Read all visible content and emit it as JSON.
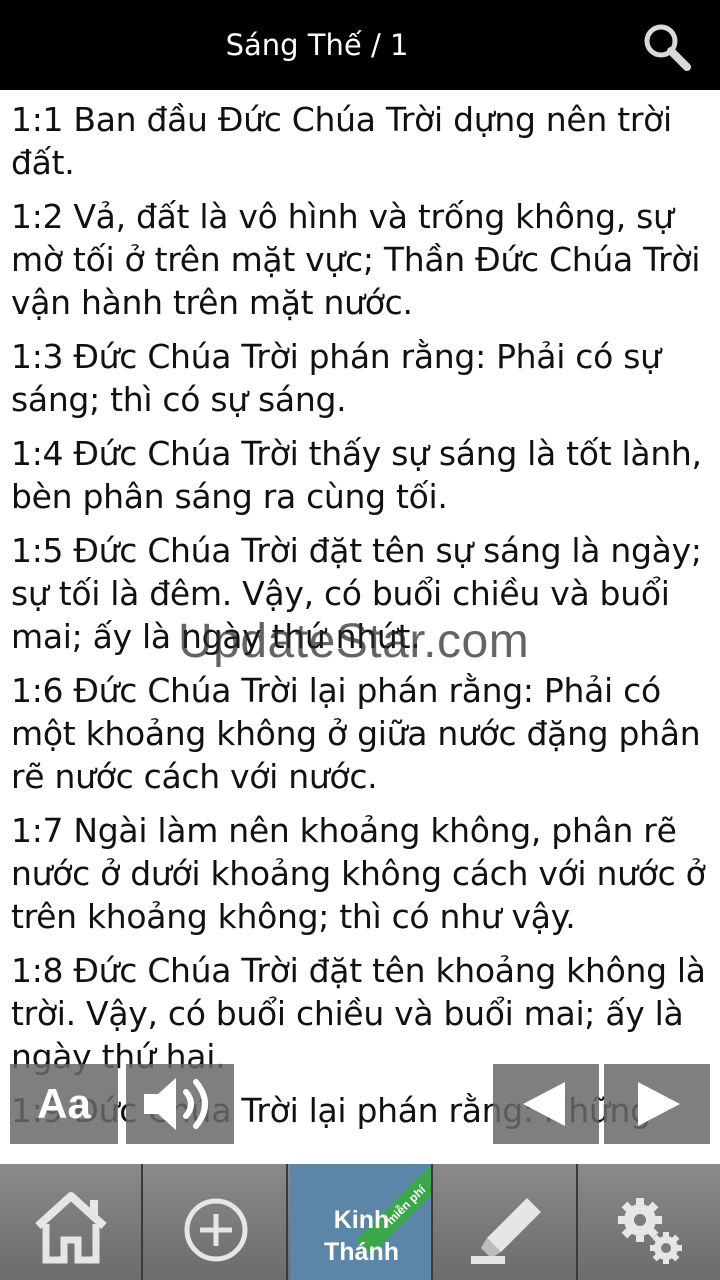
{
  "header": {
    "title": "Sáng Thế / 1",
    "search_icon": "search-icon"
  },
  "verses": [
    "1:1 Ban đầu Đức Chúa Trời dựng nên trời đất.",
    "1:2 Vả, đất là vô hình và trống không, sự mờ tối ở trên mặt vực; Thần Đức Chúa Trời vận hành trên mặt nước.",
    "1:3 Đức Chúa Trời phán rằng: Phải có sự sáng; thì có sự sáng.",
    "1:4 Đức Chúa Trời thấy sự sáng là tốt lành, bèn phân sáng ra cùng tối.",
    "1:5 Đức Chúa Trời đặt tên sự sáng là ngày; sự tối là đêm. Vậy, có buổi chiều và buổi mai; ấy là ngày thứ nhứt.",
    "1:6 Đức Chúa Trời lại phán rằng: Phải có một khoảng không ở giữa nước đặng phân rẽ nước cách với nước.",
    "1:7 Ngài làm nên khoảng không, phân rẽ nước ở dưới khoảng không cách với nước ở trên khoảng không; thì có như vậy.",
    "1:8 Đức Chúa Trời đặt tên khoảng không là trời. Vậy, có buổi chiều và buổi mai; ấy là ngày thứ hai.",
    "1:9 Đức Chúa Trời lại phán rằng: Những"
  ],
  "watermark": "UpdateStar.com",
  "controls": {
    "font_label": "Aa",
    "audio_icon": "speaker-icon",
    "prev_icon": "triangle-left-icon",
    "next_icon": "triangle-right-icon"
  },
  "bottom_nav": {
    "home_icon": "home-icon",
    "add_icon": "plus-circle-icon",
    "bible_line1": "Kinh",
    "bible_line2": "Thánh",
    "bible_ribbon": "miễn phí",
    "note_icon": "highlighter-icon",
    "settings_icon": "gears-icon"
  },
  "colors": {
    "header_bg": "#000000",
    "active_tab": "#5b86a8",
    "ribbon": "#3aa84a"
  }
}
